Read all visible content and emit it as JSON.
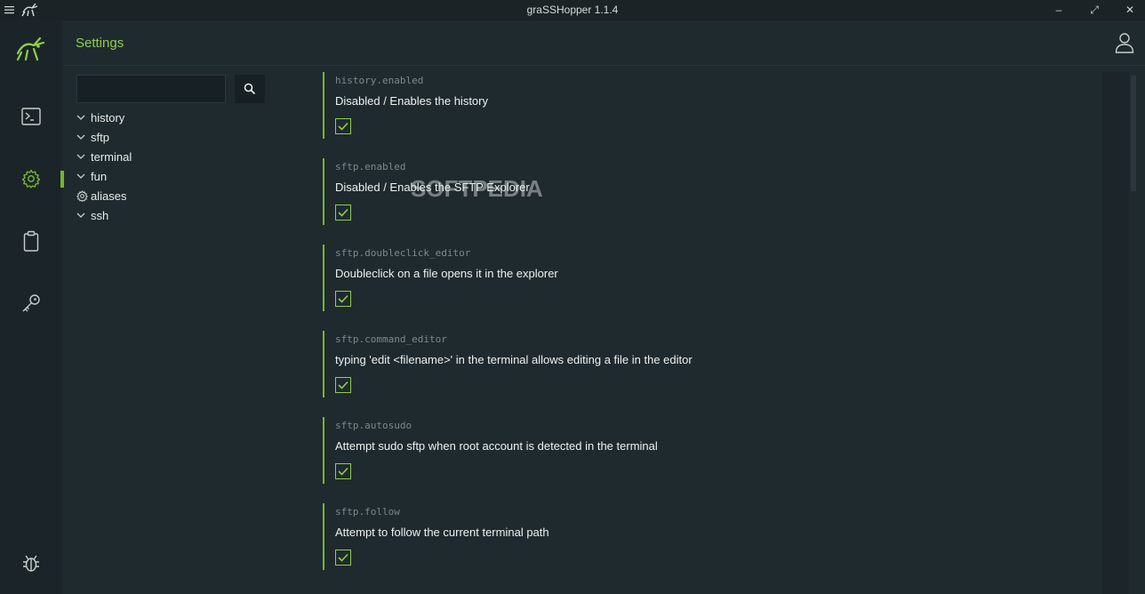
{
  "window": {
    "title": "graSSHopper 1.1.4",
    "minimize": "–",
    "maximize": "⤢",
    "close": "✕"
  },
  "rail": {
    "items": [
      {
        "name": "terminal-icon"
      },
      {
        "name": "settings-gear-icon",
        "active": true
      },
      {
        "name": "clipboard-icon"
      },
      {
        "name": "key-icon"
      }
    ],
    "bottom_icon": "bug-icon"
  },
  "header": {
    "title": "Settings"
  },
  "search": {
    "placeholder": "",
    "value": ""
  },
  "tree": {
    "items": [
      {
        "label": "history",
        "icon": "chevron-down"
      },
      {
        "label": "sftp",
        "icon": "chevron-down"
      },
      {
        "label": "terminal",
        "icon": "chevron-down"
      },
      {
        "label": "fun",
        "icon": "chevron-down"
      },
      {
        "label": "aliases",
        "icon": "gear"
      },
      {
        "label": "ssh",
        "icon": "chevron-down"
      }
    ]
  },
  "settings": [
    {
      "key": "history.enabled",
      "description": "Disabled / Enables the history",
      "checked": true
    },
    {
      "key": "sftp.enabled",
      "description": "Disabled / Enables the SFTP Explorer",
      "checked": true
    },
    {
      "key": "sftp.doubleclick_editor",
      "description": "Doubleclick on a file opens it in the explorer",
      "checked": true
    },
    {
      "key": "sftp.command_editor",
      "description": "typing 'edit <filename>' in the terminal allows editing a file in the editor",
      "checked": true
    },
    {
      "key": "sftp.autosudo",
      "description": "Attempt sudo sftp when root account is detected in the terminal",
      "checked": true
    },
    {
      "key": "sftp.follow",
      "description": "Attempt to follow the current terminal path",
      "checked": true
    }
  ],
  "watermark": "SOFTPEDIA",
  "colors": {
    "accent": "#76b82a",
    "background": "#1f2a2f",
    "rail": "#1b2529"
  }
}
